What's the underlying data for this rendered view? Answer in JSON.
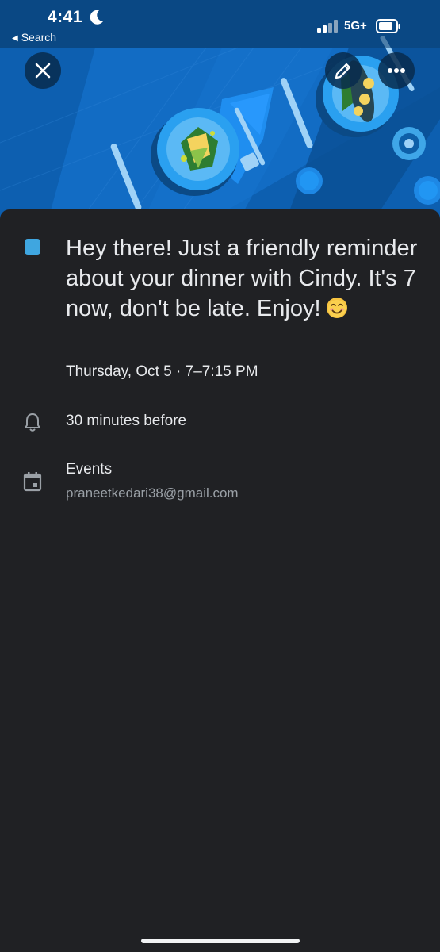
{
  "status_bar": {
    "time": "4:41",
    "back_label": "Search",
    "network": "5G+"
  },
  "header": {
    "icons": [
      "close-icon",
      "edit-icon",
      "more-icon"
    ],
    "illustration": "dinner-table-illustration"
  },
  "event": {
    "color": "#3fa6e0",
    "title": "Hey there! Just a friendly reminder about your dinner with Cindy. It's 7 now, don't be late. Enjoy!",
    "datetime": "Thursday, Oct 5 · 7–7:15 PM",
    "reminder": "30 minutes before",
    "calendar_name": "Events",
    "calendar_owner": "praneetkedari38@gmail.com"
  }
}
